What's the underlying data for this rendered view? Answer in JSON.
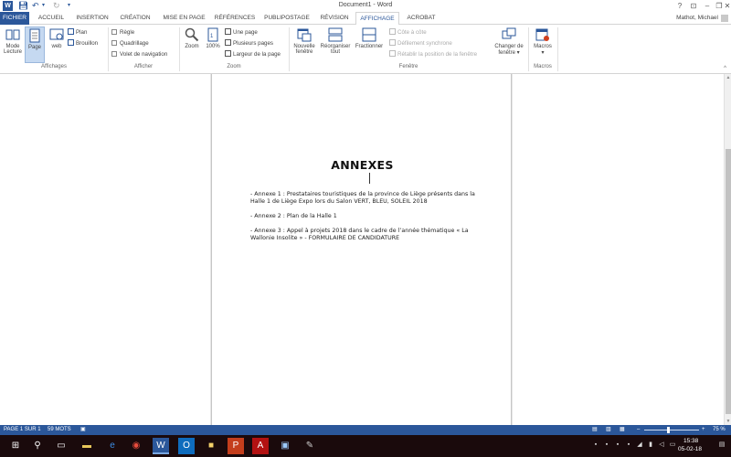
{
  "titlebar": {
    "doc_title": "Document1 - Word",
    "help": "?",
    "ribbon_display": "⊡",
    "minimize": "–",
    "restore": "❐",
    "close": "✕"
  },
  "tabs": {
    "file": "FICHIER",
    "items": [
      "ACCUEIL",
      "INSERTION",
      "CRÉATION",
      "MISE EN PAGE",
      "RÉFÉRENCES",
      "PUBLIPOSTAGE",
      "RÉVISION",
      "AFFICHAGE",
      "ACROBAT"
    ],
    "user": "Mathot, Michael"
  },
  "ribbon": {
    "affichages": {
      "label": "Affichages",
      "mode_lecture": [
        "Mode",
        "Lecture"
      ],
      "page": "Page",
      "web": "web",
      "plan": "Plan",
      "brouillon": "Brouillon"
    },
    "afficher": {
      "label": "Afficher",
      "regle": "Règle",
      "quadrillage": "Quadrillage",
      "volet": "Volet de navigation"
    },
    "zoom": {
      "label": "Zoom",
      "zoom": "Zoom",
      "hundred": "100%",
      "une_page": "Une page",
      "plusieurs_pages": "Plusieurs pages",
      "largeur": "Largeur de la page"
    },
    "fenetre": {
      "label": "Fenêtre",
      "nouvelle": [
        "Nouvelle",
        "fenêtre"
      ],
      "reorganiser": [
        "Réorganiser",
        "tout"
      ],
      "fractionner": "Fractionner",
      "cote": "Côte à côte",
      "defilement": "Défilement synchrone",
      "retablir": "Rétablir la position de la fenêtre",
      "changer": [
        "Changer de",
        "fenêtre ▾"
      ]
    },
    "macros": {
      "label": "Macros",
      "macros": [
        "Macros",
        "▾"
      ]
    },
    "collapse": "^"
  },
  "document": {
    "heading": "ANNEXES",
    "paragraphs": [
      "- Annexe 1 : Prestataires touristiques de la province de Liège présents dans la Halle 1 de Liège Expo lors du Salon VERT, BLEU, SOLEIL 2018",
      "- Annexe 2 : Plan de la Halle 1",
      "- Annexe 3 : Appel à projets 2018 dans le cadre de l’année thématique « La Wallonie Insolite » - FORMULAIRE DE CANDIDATURE"
    ]
  },
  "statusbar": {
    "page": "PAGE 1 SUR 1",
    "words": "59 MOTS",
    "zoom_minus": "–",
    "zoom_plus": "+",
    "zoom_level": "75 %"
  },
  "taskbar": {
    "time": "15:38",
    "date": "05-02-18"
  },
  "colors": {
    "accent": "#2b579a",
    "taskbar": "#1a0a0c"
  }
}
